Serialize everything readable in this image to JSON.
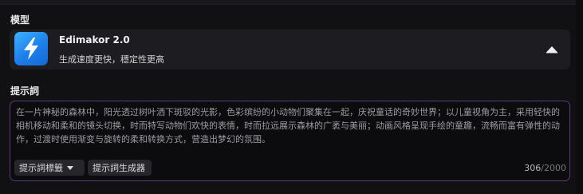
{
  "sections": {
    "model_label": "模型",
    "prompt_label": "提示詞"
  },
  "model": {
    "name": "Edimakor 2.0",
    "description": "生成速度更快，穩定性更高",
    "icon": "lightning-bolt-icon",
    "icon_color": "#2a8ff5",
    "expanded": true
  },
  "prompt": {
    "text": "在一片神秘的森林中，阳光透过树叶洒下斑驳的光影，色彩缤纷的小动物们聚集在一起，庆祝童话的奇妙世界；以儿童视角为主，采用轻快的相机移动和柔和的镜头切换，时而特写动物们欢快的表情，时而拉远展示森林的广袤与美丽；动画风格呈现手绘的童趣，流畅而富有弹性的动作，过渡时使用渐变与旋转的柔和转换方式，营造出梦幻的氛围。",
    "chips": {
      "tags_label": "提示詞標籤",
      "generator_label": "提示詞生成器"
    },
    "char_count": "306",
    "char_max": "/2000",
    "border_color": "#5c3c78"
  }
}
